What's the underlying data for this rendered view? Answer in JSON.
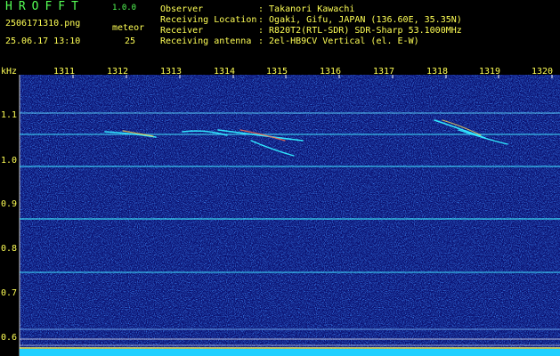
{
  "header": {
    "app_title": "HROFFT",
    "app_version": "1.0.0",
    "filename": "2506171310.png",
    "datetime": "25.06.17 13:10",
    "meteor_label": "meteor",
    "meteor_count": "25",
    "info": [
      {
        "label": "Observer",
        "value": ": Takanori Kawachi"
      },
      {
        "label": "Receiving Location",
        "value": ": Ogaki, Gifu, JAPAN (136.60E, 35.35N)"
      },
      {
        "label": "Receiver",
        "value": ": R820T2(RTL-SDR) SDR-Sharp 53.1000MHz"
      },
      {
        "label": "Receiving antenna",
        "value": ": 2el-HB9CV Vertical (el. E-W)"
      }
    ]
  },
  "spectrogram": {
    "unit_label": "kHz",
    "time_ticks": [
      "1311",
      "1312",
      "1313",
      "1314",
      "1315",
      "1316",
      "1317",
      "1318",
      "1319",
      "1320"
    ],
    "freq_ticks": [
      "1.1",
      "1.0",
      "0.9",
      "0.8",
      "0.7",
      "0.6"
    ],
    "colors": {
      "background": "#0a1070",
      "line": "#40e0ff",
      "axis_text": "#ffff55"
    }
  }
}
